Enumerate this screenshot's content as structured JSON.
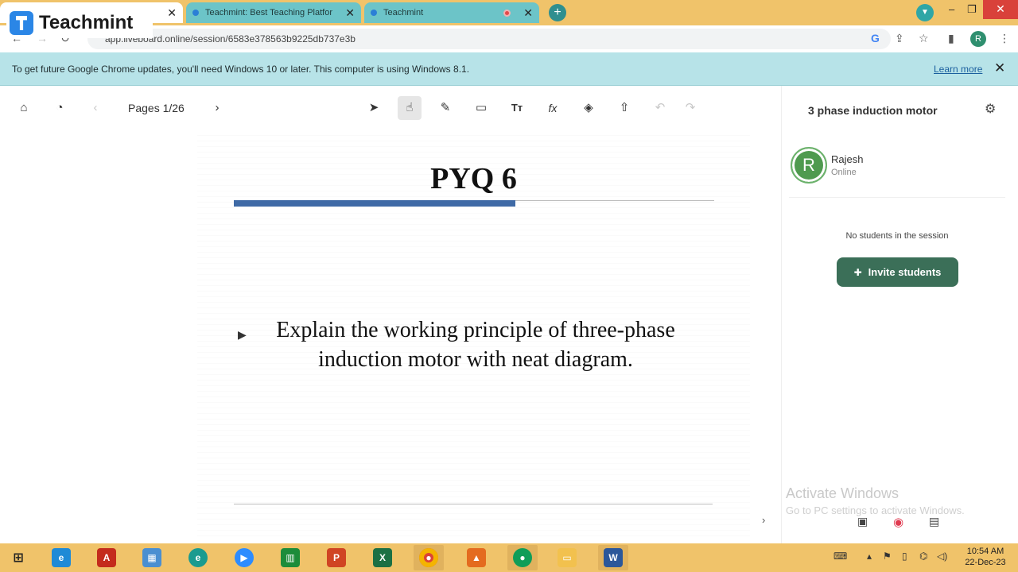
{
  "browser": {
    "tabs": [
      {
        "title": "",
        "close": "✕"
      },
      {
        "title": "Teachmint: Best Teaching Platfor",
        "close": "✕"
      },
      {
        "title": "Teachmint",
        "close": "✕"
      }
    ],
    "new_tab": "+",
    "url": "app.liveboard.online/session/6583e378563b9225db737e3b",
    "profile_initial": "R"
  },
  "logo": {
    "text": "Teachmint"
  },
  "infobar": {
    "message": "To get future Google Chrome updates, you'll need Windows 10 or later. This computer is using Windows 8.1.",
    "learn_more": "Learn more",
    "close": "✕"
  },
  "toolbar": {
    "pages_label": "Pages 1/26"
  },
  "slide": {
    "title": "PYQ 6",
    "body": "Explain the working principle of three-phase induction motor with neat diagram."
  },
  "panel": {
    "title": "3 phase induction motor",
    "user_initial": "R",
    "user_name": "Rajesh",
    "user_status": "Online",
    "empty_message": "No students in the session",
    "invite_label": "Invite students"
  },
  "watermark": {
    "line1": "Activate Windows",
    "line2": "Go to PC settings to activate Windows."
  },
  "taskbar": {
    "time": "10:54 AM",
    "date": "22-Dec-23"
  }
}
